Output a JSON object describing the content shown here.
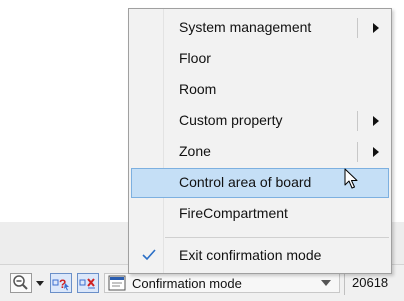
{
  "context_menu": {
    "items": [
      {
        "label": "System management",
        "submenu": true
      },
      {
        "label": "Floor",
        "submenu": false
      },
      {
        "label": "Room",
        "submenu": false
      },
      {
        "label": "Custom property",
        "submenu": true
      },
      {
        "label": "Zone",
        "submenu": true
      },
      {
        "label": "Control area of board",
        "submenu": false,
        "highlighted": true
      },
      {
        "label": "FireCompartment",
        "submenu": false
      },
      {
        "label": "Exit confirmation mode",
        "submenu": false,
        "checked": true
      }
    ]
  },
  "statusbar": {
    "mode_value": "Confirmation mode",
    "coordinate": "20618",
    "icons": [
      "zoom-icon",
      "dropdown-arrow-icon",
      "query-icon",
      "delete-icon",
      "confirmation-mode-icon"
    ]
  },
  "colors": {
    "menu_background": "#f2f2f2",
    "highlight_background": "#c5dff6",
    "highlight_border": "#7db0e0",
    "toolbar_button_blue": "#dbe7fa",
    "check_blue": "#2b6fc6"
  }
}
